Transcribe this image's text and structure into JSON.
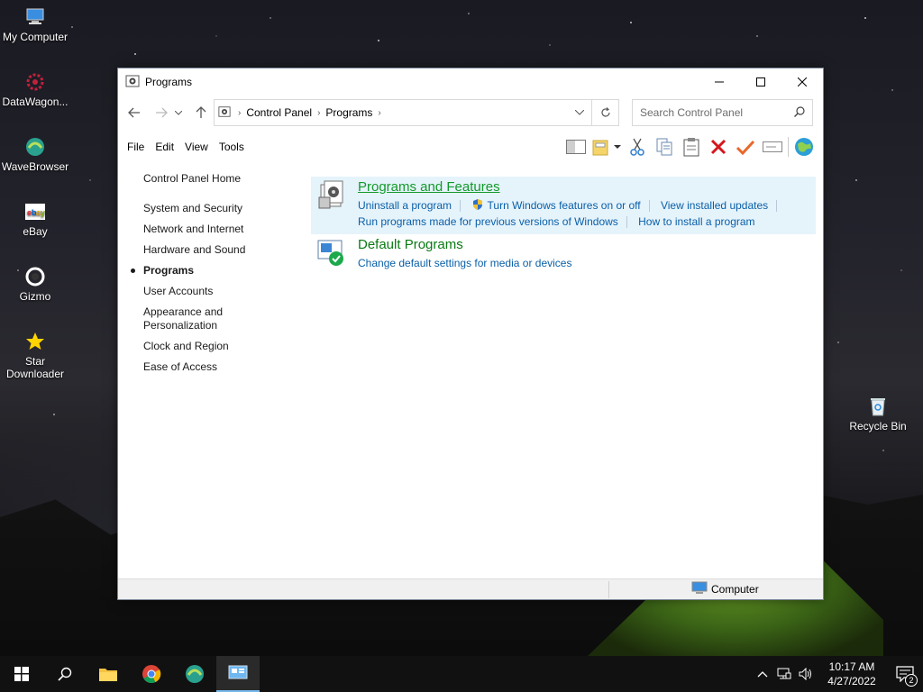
{
  "desktop": {
    "icons": [
      {
        "label": "My Computer",
        "icon": "computer-icon"
      },
      {
        "label": "DataWagon...",
        "icon": "datawagon-icon"
      },
      {
        "label": "WaveBrowser",
        "icon": "wavebrowser-icon"
      },
      {
        "label": "eBay",
        "icon": "ebay-icon"
      },
      {
        "label": "Gizmo",
        "icon": "gizmo-icon"
      },
      {
        "label": "Star Downloader",
        "icon": "star-icon"
      },
      {
        "label": "Recycle Bin",
        "icon": "recycle-bin-icon"
      }
    ]
  },
  "window": {
    "title": "Programs",
    "address": {
      "crumbs": [
        "Control Panel",
        "Programs"
      ]
    },
    "search": {
      "placeholder": "Search Control Panel"
    },
    "menu": [
      "File",
      "Edit",
      "View",
      "Tools"
    ],
    "leftnav": {
      "home": "Control Panel Home",
      "items": [
        {
          "label": "System and Security"
        },
        {
          "label": "Network and Internet"
        },
        {
          "label": "Hardware and Sound"
        },
        {
          "label": "Programs",
          "active": true
        },
        {
          "label": "User Accounts"
        },
        {
          "label": "Appearance and Personalization"
        },
        {
          "label": "Clock and Region"
        },
        {
          "label": "Ease of Access"
        }
      ]
    },
    "categories": [
      {
        "title": "Programs and Features",
        "links_row1": [
          "Uninstall a program",
          "Turn Windows features on or off",
          "View installed updates"
        ],
        "links_row2": [
          "Run programs made for previous versions of Windows",
          "How to install a program"
        ]
      },
      {
        "title": "Default Programs",
        "links_row1": [
          "Change default settings for media or devices"
        ]
      }
    ],
    "statusbar": {
      "location": "Computer"
    }
  },
  "taskbar": {
    "clock_time": "10:17 AM",
    "clock_date": "4/27/2022",
    "notification_count": "2"
  }
}
